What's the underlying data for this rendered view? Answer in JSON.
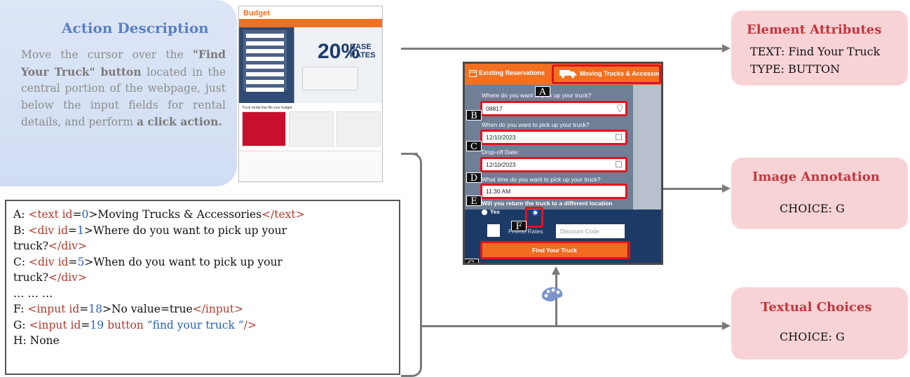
{
  "action": {
    "title": "Action Description",
    "text_parts": [
      "Move the cursor over the ",
      "\"Find Your Truck\" button",
      " located in the central portion of the webpage, just below the input fields for rental details, and perform ",
      "a click action."
    ]
  },
  "thumbnail": {
    "logo": "Budget",
    "headline": "20%",
    "headline2": "BASE RATES",
    "fits_label": "Truck rental that fits your budget"
  },
  "element_list": {
    "lines": [
      {
        "key": "A: ",
        "open": "<text ",
        "attr": "id",
        "eq": "=",
        "num": "0",
        "close": ">",
        "content": "Moving Trucks & Accessories",
        "end": "</text>"
      },
      {
        "key": "B: ",
        "open": "<div ",
        "attr": "id",
        "eq": "=",
        "num": "1",
        "close": ">",
        "content": "Where do you want to pick up your",
        "end": ""
      },
      {
        "key": "",
        "open": "",
        "attr": "",
        "eq": "",
        "num": "",
        "close": "",
        "content": "truck?",
        "end": "</div>"
      },
      {
        "key": "C: ",
        "open": "<div ",
        "attr": "id",
        "eq": "=",
        "num": "5",
        "close": ">",
        "content": "When do you want to pick up your",
        "end": ""
      },
      {
        "key": "",
        "open": "",
        "attr": "",
        "eq": "",
        "num": "",
        "close": "",
        "content": "truck?",
        "end": "</div>"
      },
      {
        "key": "… … …",
        "open": "",
        "attr": "",
        "eq": "",
        "num": "",
        "close": "",
        "content": "",
        "end": ""
      },
      {
        "key": "F: ",
        "open": "<input ",
        "attr": "id",
        "eq": "=",
        "num": "18",
        "close": ">",
        "content": "No value=true",
        "end": "</input>"
      },
      {
        "key": "G: ",
        "open": "<input ",
        "attr": "id",
        "eq": "=",
        "num": "19",
        "close": " button ",
        "content": "“find your truck ”",
        "end": "/>"
      },
      {
        "key": "H: None",
        "open": "",
        "attr": "",
        "eq": "",
        "num": "",
        "close": "",
        "content": "",
        "end": ""
      }
    ]
  },
  "screenshot": {
    "tab1": "Existing Reservations",
    "tab2": "Moving Trucks & Accessories",
    "q1": "Where do you want to pick up your truck?",
    "v1": "08817",
    "q2": "When do you want to pick up your truck?",
    "v2": "12/10/2023",
    "q3": "Drop-off Date:",
    "v3": "12/10/2023",
    "q4": "What time do you want to pick up your truck?",
    "v4": "11:30 AM",
    "q5": "Will you return the truck to a different location",
    "yes": "Yes",
    "promo": "Promo Rates",
    "discount": "Discount Code",
    "button": "Find Your Truck",
    "markers": [
      "A",
      "B",
      "C",
      "D",
      "E",
      "F",
      "G"
    ]
  },
  "cards": {
    "attributes": {
      "title": "Element Attributes",
      "line1": "TEXT: Find Your Truck",
      "line2": "TYPE: BUTTON"
    },
    "image": {
      "title": "Image Annotation",
      "line1": "CHOICE: G"
    },
    "textual": {
      "title": "Textual Choices",
      "line1": "CHOICE: G"
    }
  }
}
